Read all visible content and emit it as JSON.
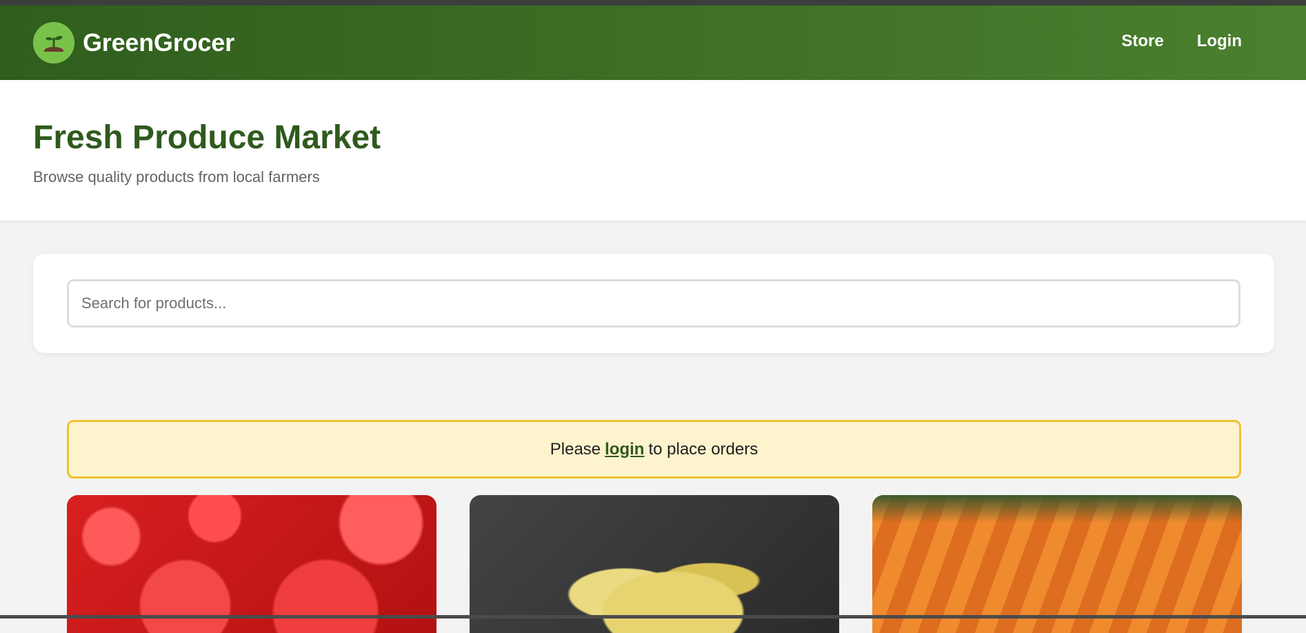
{
  "header": {
    "brand_name": "GreenGrocer",
    "logo_icon": "seedling-icon",
    "nav": [
      {
        "label": "Store"
      },
      {
        "label": "Login"
      }
    ]
  },
  "hero": {
    "title": "Fresh Produce Market",
    "subtitle": "Browse quality products from local farmers"
  },
  "search": {
    "placeholder": "Search for products..."
  },
  "notice": {
    "prefix": "Please",
    "link": "login",
    "suffix": "to place orders"
  },
  "products": [
    {
      "image": "apples"
    },
    {
      "image": "bananas"
    },
    {
      "image": "carrots"
    }
  ],
  "colors": {
    "nav_green": "#3f7024",
    "title_green": "#2f5a1d",
    "notice_bg": "#fdf3cd",
    "notice_border": "#f2c12e"
  }
}
